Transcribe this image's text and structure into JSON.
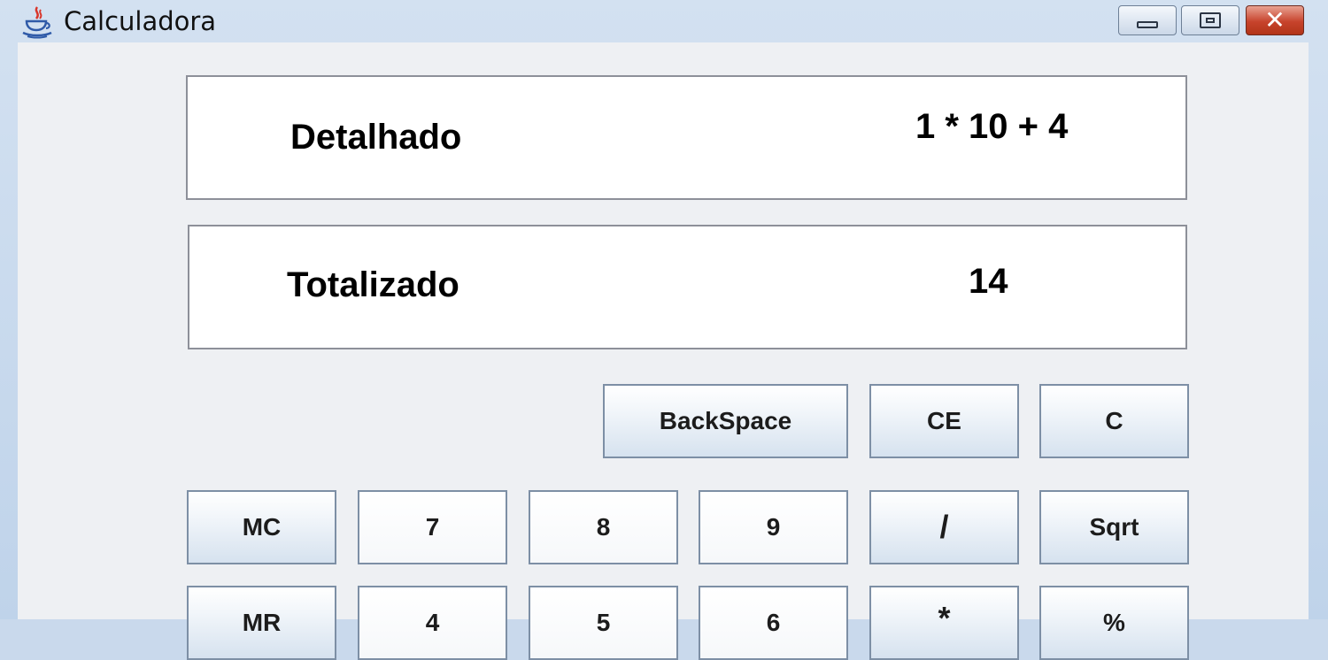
{
  "window": {
    "title": "Calculadora",
    "icons": {
      "app": "java-cup-icon",
      "minimize": "minimize-icon",
      "maximize": "maximize-icon",
      "close": "close-icon"
    }
  },
  "display": {
    "detail_label": "Detalhado",
    "detail_value": "1 * 10 + 4",
    "total_label": "Totalizado",
    "total_value": "14"
  },
  "buttons": {
    "backspace": "BackSpace",
    "ce": "CE",
    "c": "C",
    "mc": "MC",
    "seven": "7",
    "eight": "8",
    "nine": "9",
    "divide": "/",
    "sqrt": "Sqrt",
    "mr": "MR",
    "four": "4",
    "five": "5",
    "six": "6",
    "multiply": "*",
    "percent": "%"
  }
}
